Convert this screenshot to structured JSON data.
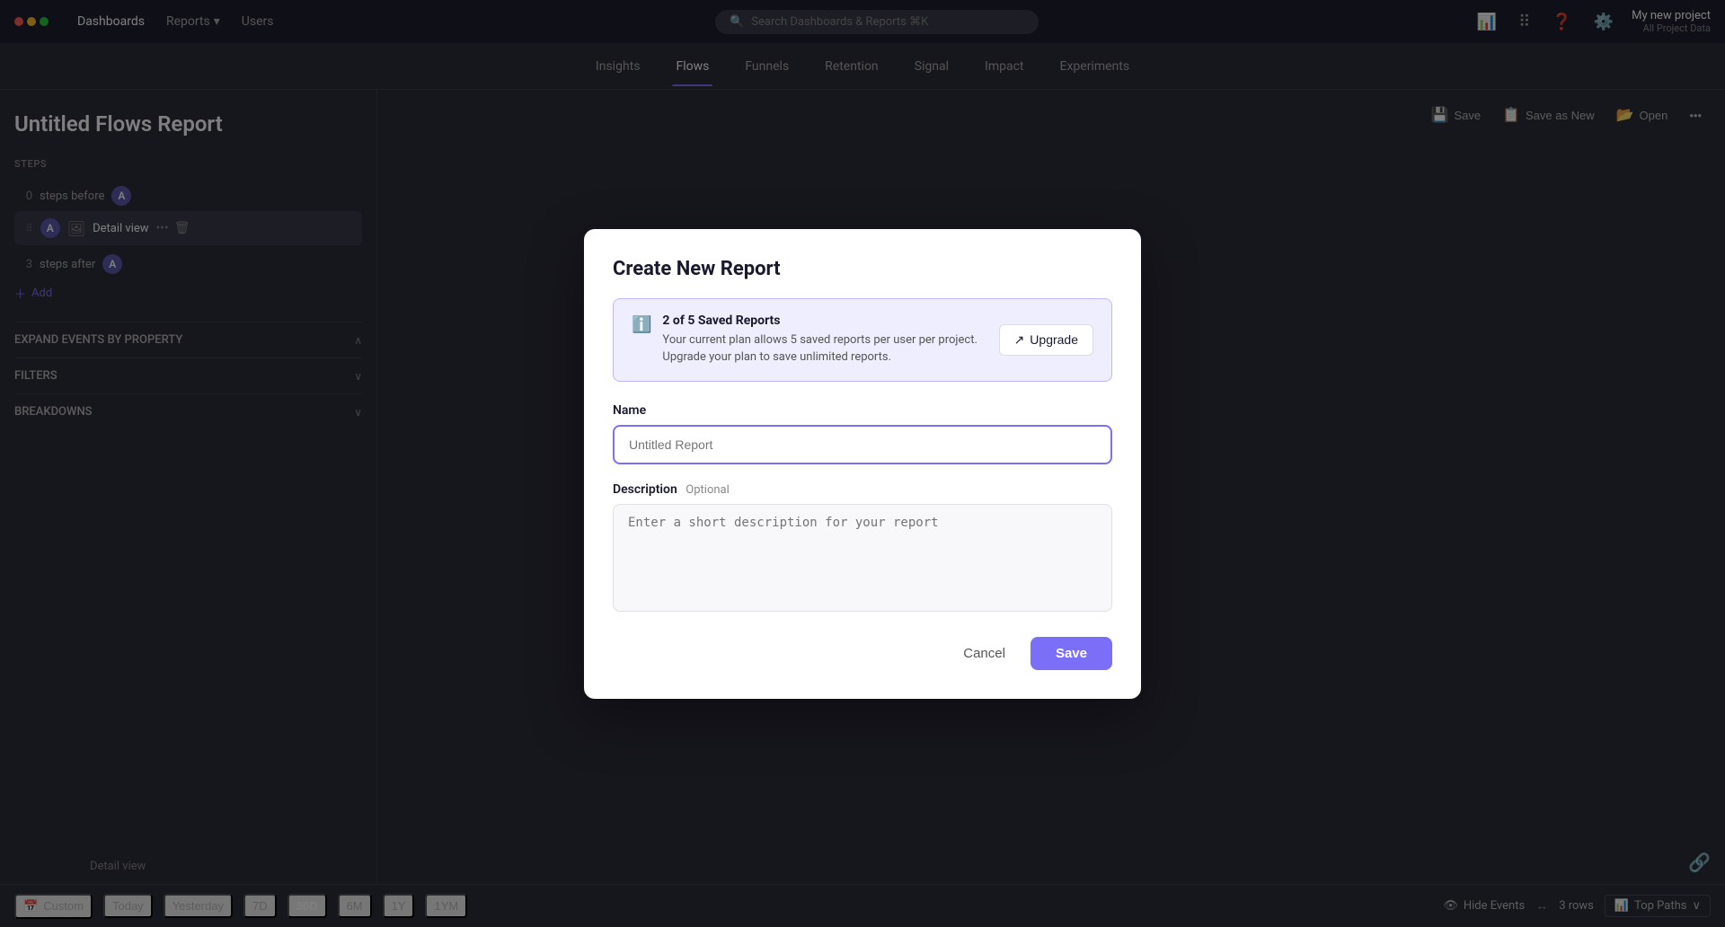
{
  "topNav": {
    "links": [
      "Dashboards",
      "Reports",
      "Users"
    ],
    "reportsArrow": "▾",
    "searchPlaceholder": "Search Dashboards & Reports ⌘K",
    "project": {
      "name": "My new project",
      "subtitle": "All Project Data"
    }
  },
  "subNav": {
    "tabs": [
      "Insights",
      "Flows",
      "Funnels",
      "Retention",
      "Signal",
      "Impact",
      "Experiments"
    ],
    "activeTab": "Flows"
  },
  "reportPage": {
    "title": "Untitled Flows Report",
    "sections": {
      "steps": "STEPS",
      "stepsBefore": "steps before",
      "stepsAfter": "steps after",
      "stepLetter": "A",
      "stepNumber0": "0",
      "stepNumber3": "3",
      "detailView": "Detail view",
      "addLabel": "Add",
      "expandByProperty": "EXPAND EVENTS BY PROPERTY",
      "filters": "FILTERS",
      "breakdowns": "BREAKDOWNS"
    },
    "actionBar": {
      "save": "Save",
      "saveAsNew": "Save as New",
      "open": "Open"
    },
    "bottomBar": {
      "dateBtns": [
        "Custom",
        "Today",
        "Yesterday",
        "7D",
        "30D",
        "6M",
        "1Y",
        "1YM"
      ],
      "activeDate": "30D",
      "hideEvents": "Hide Events",
      "rows": "3 rows",
      "topPaths": "Top Paths"
    }
  },
  "modal": {
    "title": "Create New Report",
    "infoBanner": {
      "title": "2 of 5 Saved Reports",
      "desc": "Your current plan allows 5 saved reports per user per project. Upgrade your plan to save unlimited reports.",
      "upgradeBtn": "Upgrade"
    },
    "nameLabel": "Name",
    "namePlaceholder": "Untitled Report",
    "descLabel": "Description",
    "descOptional": "Optional",
    "descPlaceholder": "Enter a short description for your report",
    "cancelBtn": "Cancel",
    "saveBtn": "Save"
  }
}
